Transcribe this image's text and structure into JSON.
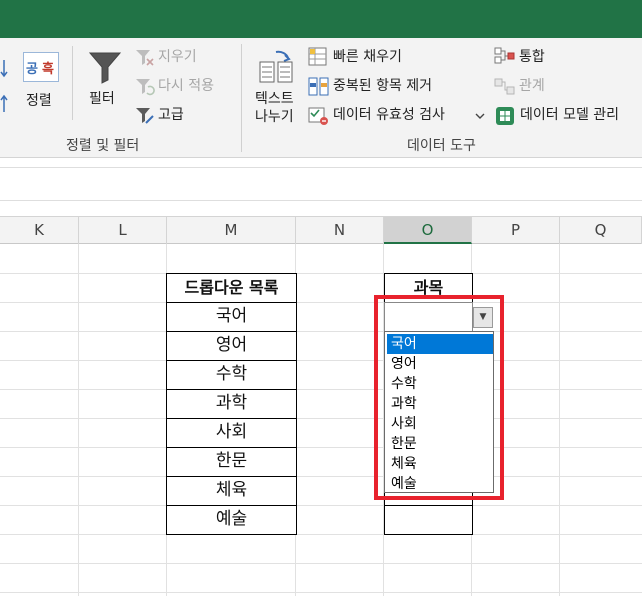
{
  "ribbon": {
    "sort_label": "정렬",
    "filter_label": "필터",
    "clear_label": "지우기",
    "reapply_label": "다시 적용",
    "advanced_label": "고급",
    "sort_filter_group": "정렬 및 필터",
    "text_to_columns_line1": "텍스트",
    "text_to_columns_line2": "나누기",
    "flash_fill_label": "빠른 채우기",
    "remove_duplicates_label": "중복된 항목 제거",
    "data_validation_label": "데이터 유효성 검사",
    "consolidate_label": "통합",
    "relationships_label": "관계",
    "data_model_label": "데이터 모델 관리",
    "data_tools_group": "데이터 도구",
    "sort_icon_chars": [
      "공",
      "흑"
    ]
  },
  "columns": [
    "K",
    "L",
    "M",
    "N",
    "O",
    "P",
    "Q"
  ],
  "selected_column": "O",
  "table_m": {
    "header": "드롭다운 목록",
    "items": [
      "국어",
      "영어",
      "수학",
      "과학",
      "사회",
      "한문",
      "체육",
      "예술"
    ]
  },
  "table_o": {
    "header": "과목",
    "value": ""
  },
  "dropdown": {
    "arrow": "▼",
    "options": [
      "국어",
      "영어",
      "수학",
      "과학",
      "사회",
      "한문",
      "체육",
      "예술"
    ],
    "selected_index": 0
  },
  "colors": {
    "excel_green": "#217346",
    "highlight_red": "#e8222d",
    "selection_blue": "#0078d7"
  }
}
